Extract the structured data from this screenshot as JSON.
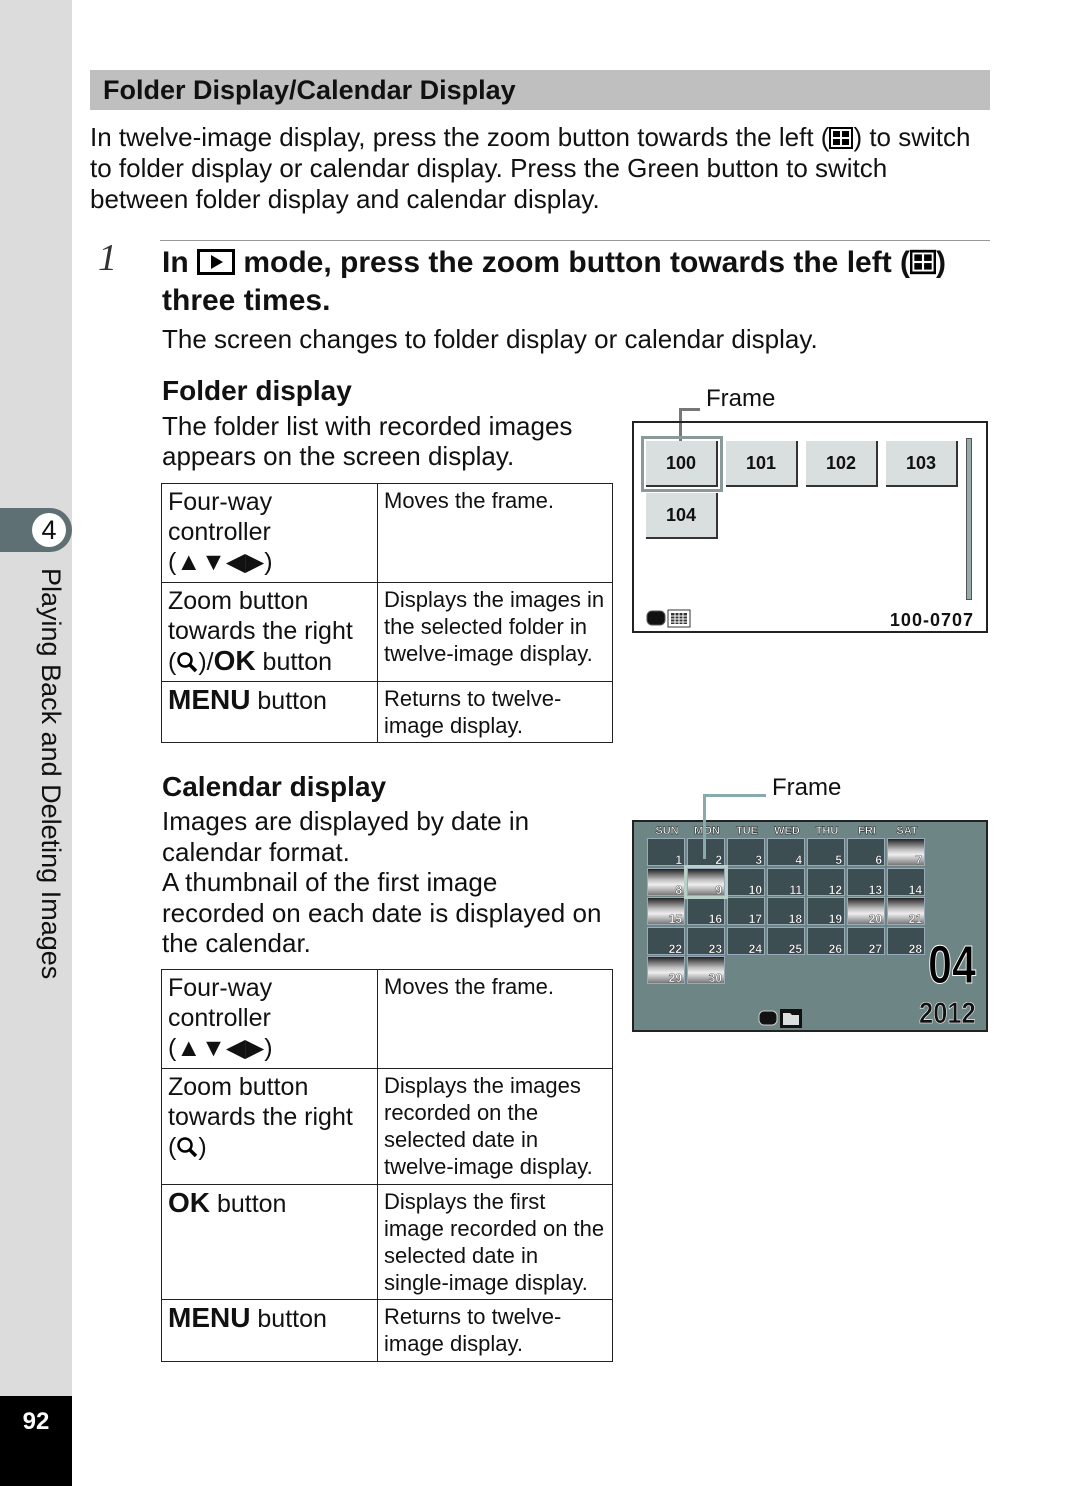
{
  "sidebar": {
    "chapter_number": "4",
    "chapter_title": "Playing Back and Deleting Images",
    "page_number": "92"
  },
  "section": {
    "title": "Folder Display/Calendar Display",
    "intro": [
      "In twelve-image display, press the zoom button towards the left (",
      "grid-icon",
      ") to switch to folder display or calendar display. Press the Green button to switch between folder display and calendar display."
    ]
  },
  "step": {
    "number": "1",
    "text_a": "In ",
    "text_b": " mode, press the zoom button towards the left (",
    "text_c": ") three times.",
    "sub": "The screen changes to folder display or calendar display."
  },
  "folder": {
    "title": "Folder display",
    "desc": "The folder list with recorded images appears on the screen display.",
    "rows": [
      {
        "key": "Four-way controller",
        "arrows": "(▲▼◀▶)",
        "val": "Moves the frame."
      },
      {
        "key": "Zoom button towards the right",
        "key2": ")/",
        "ok": "OK",
        "key3": " button",
        "val": "Displays the images in the selected folder in twelve-image display."
      },
      {
        "menu": "MENU",
        "key": " button",
        "val": "Returns to twelve-image display."
      }
    ],
    "screen": {
      "frame_label": "Frame",
      "folders": [
        "100",
        "101",
        "102",
        "103",
        "104"
      ],
      "selected": "100",
      "file": "100-0707"
    }
  },
  "calendar": {
    "title": "Calendar display",
    "desc1": "Images are displayed by date in calendar format.",
    "desc2": "A thumbnail of the first image recorded on each date is displayed on the calendar.",
    "rows": [
      {
        "key": "Four-way controller",
        "arrows": "(▲▼◀▶)",
        "val": "Moves the frame."
      },
      {
        "key": "Zoom button towards the right",
        "key2": ")",
        "val": "Displays the images recorded on the selected date in twelve-image display."
      },
      {
        "ok": "OK",
        "key": " button",
        "val": "Displays the first image recorded on the selected date in single-image display."
      },
      {
        "menu": "MENU",
        "key": " button",
        "val": "Returns to twelve-image display."
      }
    ],
    "screen": {
      "frame_label": "Frame",
      "weekdays": [
        "SUN",
        "MON",
        "TUE",
        "WED",
        "THU",
        "FRI",
        "SAT"
      ],
      "first_weekday": 0,
      "days": 30,
      "photo_days": [
        7,
        8,
        9,
        15,
        20,
        21,
        29,
        30
      ],
      "selected_day": 9,
      "month": "04",
      "year": "2012"
    }
  },
  "colors": {
    "header_bg": "#bfbfbf",
    "tab": "#5e7074",
    "cal_bg": "#6e8585",
    "cal_cell": "#3d4e52"
  }
}
